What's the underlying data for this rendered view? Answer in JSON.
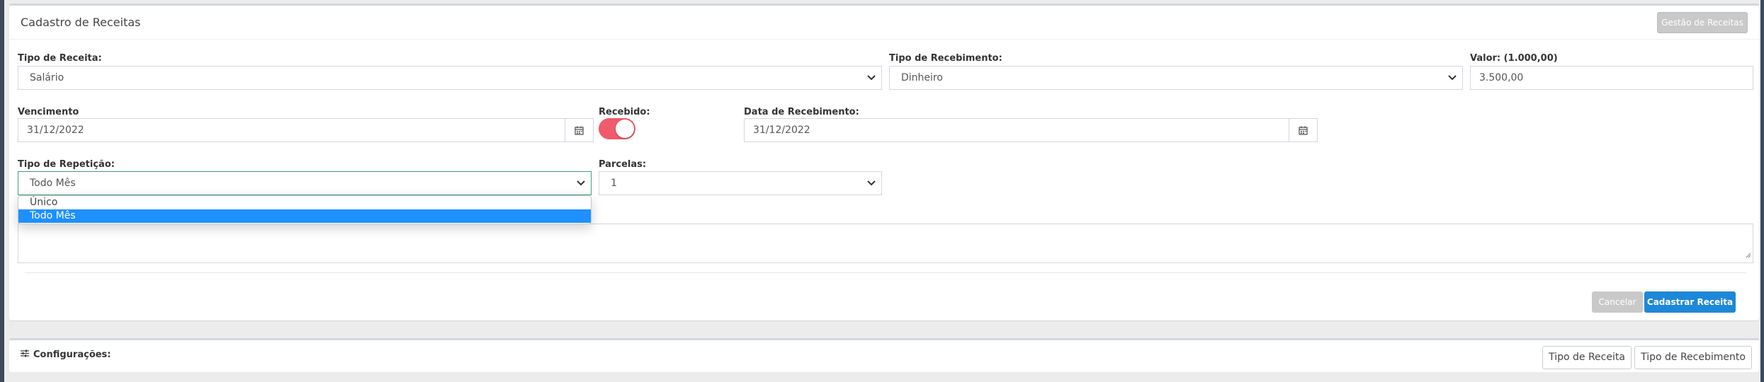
{
  "panel": {
    "title": "Cadastro de Receitas",
    "manage_button": "Gestão de Receitas"
  },
  "form": {
    "tipo_receita": {
      "label": "Tipo de Receita:",
      "value": "Salário"
    },
    "tipo_recebimento": {
      "label": "Tipo de Recebimento:",
      "value": "Dinheiro"
    },
    "valor": {
      "label": "Valor: (1.000,00)",
      "value": "3.500,00"
    },
    "vencimento": {
      "label": "Vencimento",
      "value": "31/12/2022"
    },
    "recebido": {
      "label": "Recebido:",
      "checked": true
    },
    "data_recebimento": {
      "label": "Data de Recebimento:",
      "value": "31/12/2022"
    },
    "tipo_repeticao": {
      "label": "Tipo de Repetição:",
      "value": "Todo Mês",
      "options": [
        "Único",
        "Todo Mês"
      ],
      "selected_index": 1
    },
    "parcelas": {
      "label": "Parcelas:",
      "value": "1"
    }
  },
  "actions": {
    "cancel": "Cancelar",
    "submit": "Cadastrar Receita"
  },
  "config": {
    "title": "Configurações:",
    "buttons": [
      "Tipo de Receita",
      "Tipo de Recebimento"
    ]
  },
  "colors": {
    "toggle_on": "#ef5b6d",
    "primary": "#1e88d8",
    "selected_option": "#1e90ff",
    "disabled": "#c9c9c9"
  },
  "icons": {
    "calendar": "calendar-icon",
    "chevron": "chevron-down-icon",
    "settings": "sliders-icon"
  }
}
